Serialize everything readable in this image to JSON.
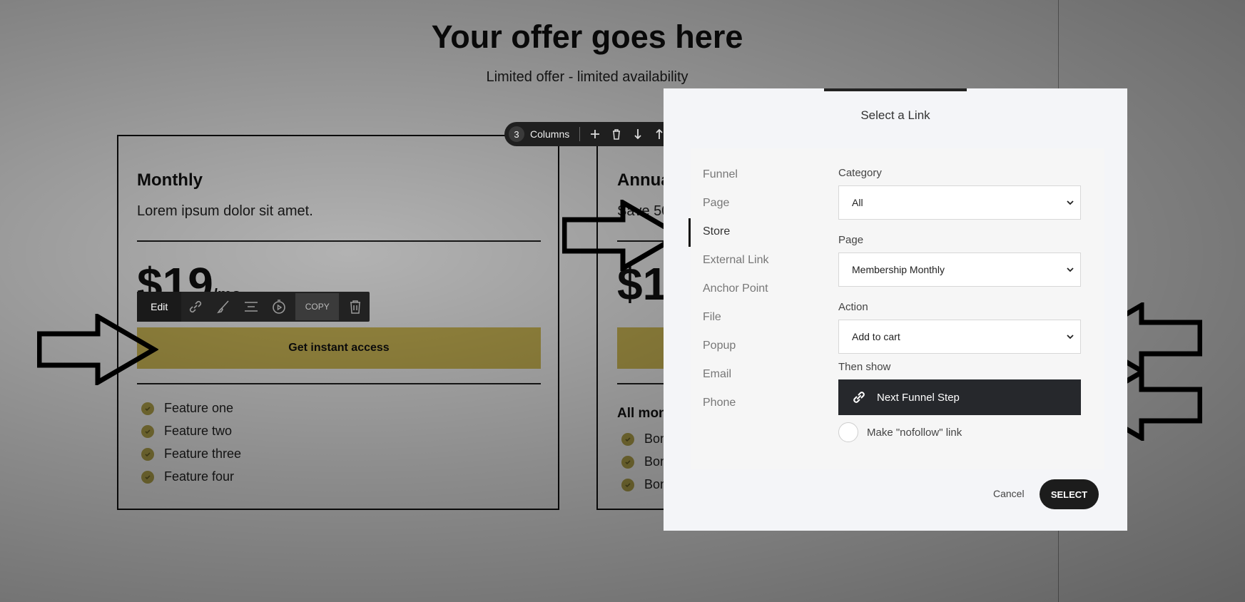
{
  "hero": {
    "title": "Your offer goes here",
    "subtitle": "Limited offer - limited availability"
  },
  "columns_toolbar": {
    "count": "3",
    "label": "Columns"
  },
  "card_monthly": {
    "title": "Monthly",
    "description": "Lorem ipsum dolor sit amet.",
    "price": "$19",
    "period": "/mo",
    "cta": "Get instant access",
    "features": [
      "Feature one",
      "Feature two",
      "Feature three",
      "Feature four"
    ]
  },
  "card_annual": {
    "title": "Annua",
    "description": "Save 50",
    "price": "$1",
    "section": "All mon",
    "bonuses": [
      "Bon",
      "Bon",
      "Bon"
    ]
  },
  "element_toolbar": {
    "edit_label": "Edit",
    "copy_label": "COPY"
  },
  "modal": {
    "title": "Select a Link",
    "nav": [
      "Funnel",
      "Page",
      "Store",
      "External Link",
      "Anchor Point",
      "File",
      "Popup",
      "Email",
      "Phone"
    ],
    "active_nav": "Store",
    "category": {
      "label": "Category",
      "value": "All"
    },
    "page": {
      "label": "Page",
      "value": "Membership Monthly"
    },
    "action": {
      "label": "Action",
      "value": "Add to cart"
    },
    "then_show": {
      "label": "Then show",
      "value": "Next Funnel Step"
    },
    "nofollow_label": "Make \"nofollow\" link",
    "cancel_label": "Cancel",
    "select_label": "SELECT"
  },
  "colors": {
    "cta": "#d8c25a",
    "modal_bg": "#f4f5f8",
    "dark_button": "#26282c"
  }
}
